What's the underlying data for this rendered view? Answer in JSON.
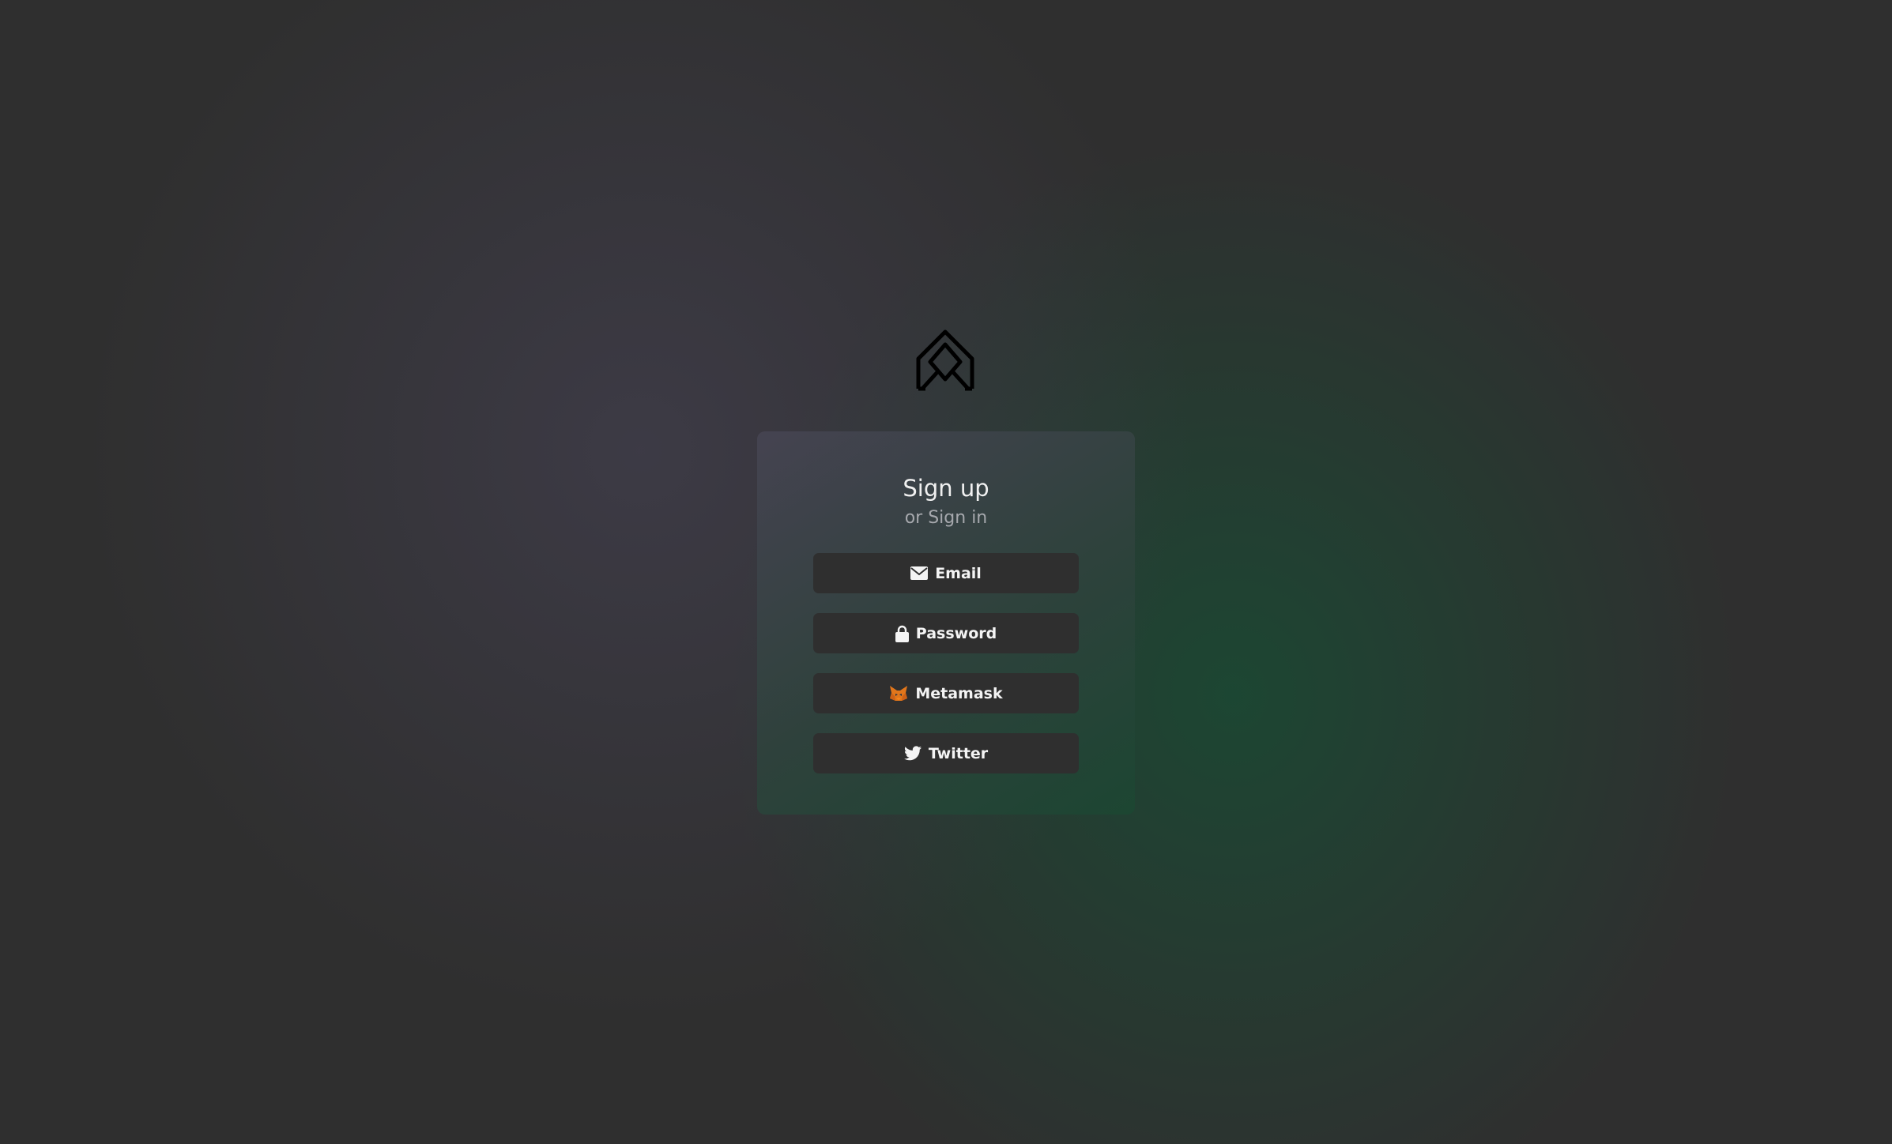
{
  "auth": {
    "title": "Sign up",
    "subtitle": "or Sign in",
    "buttons": [
      {
        "label": "Email",
        "icon": "envelope-icon"
      },
      {
        "label": "Password",
        "icon": "lock-icon"
      },
      {
        "label": "Metamask",
        "icon": "metamask-fox-icon"
      },
      {
        "label": "Twitter",
        "icon": "twitter-bird-icon"
      }
    ]
  },
  "colors": {
    "background": "#2f2f2f",
    "button_background": "#2f2f2f",
    "button_text": "#f4f4f4",
    "title_text": "#f0f0f0",
    "subtitle_text": "#a6a8ad",
    "metamask_orange": "#e2761b"
  }
}
